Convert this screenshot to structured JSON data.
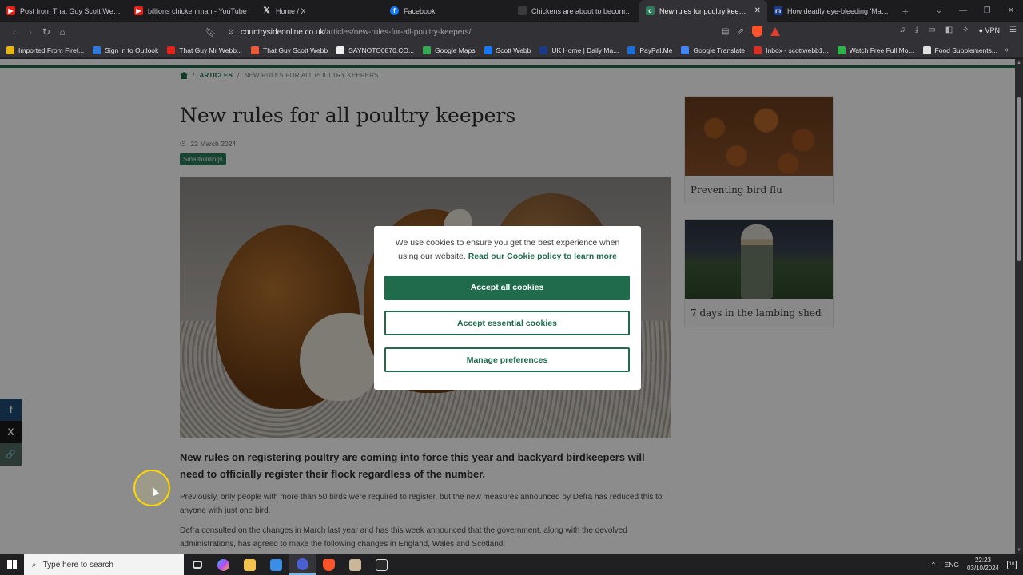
{
  "browser": {
    "tabs": [
      {
        "label": "Post from That Guy Scott Webb - Y",
        "icon": "youtube-icon",
        "color": "#e62117"
      },
      {
        "label": "billions chicken man - YouTube",
        "icon": "youtube-icon",
        "color": "#e62117"
      },
      {
        "label": "Home / X",
        "icon": "x-icon",
        "color": "#e6e6e6"
      },
      {
        "label": "Facebook",
        "icon": "facebook-icon",
        "color": "#1877f2"
      },
      {
        "label": "Chickens are about to become illeg",
        "icon": "generic-icon",
        "color": "#3a3a3a"
      },
      {
        "label": "New rules for poultry keepers",
        "icon": "countryside-icon",
        "color": "#2b7a5a",
        "active": true
      },
      {
        "label": "How deadly eye-bleeding 'Marburg",
        "icon": "newspaper-icon",
        "color": "#1a3a8a"
      }
    ],
    "url_domain": "countrysideonline.co.uk",
    "url_path": "/articles/new-rules-for-all-poultry-keepers/",
    "vpn_label": "VPN",
    "bookmarks": [
      {
        "label": "Imported From Firef...",
        "color": "#e7b416"
      },
      {
        "label": "Sign in to Outlook",
        "color": "#2f7ad8"
      },
      {
        "label": "That Guy Mr Webb...",
        "color": "#e62117"
      },
      {
        "label": "That Guy Scott Webb",
        "color": "#ef5a3a"
      },
      {
        "label": "SAYNOTO0870.CO...",
        "color": "#f0f0f0"
      },
      {
        "label": "Google Maps",
        "color": "#34a853"
      },
      {
        "label": "Scott Webb",
        "color": "#1877f2"
      },
      {
        "label": "UK Home | Daily Ma...",
        "color": "#1a3a8a"
      },
      {
        "label": "PayPal.Me",
        "color": "#1a6ed8"
      },
      {
        "label": "Google Translate",
        "color": "#4285f4"
      },
      {
        "label": "Inbox - scottwebb1...",
        "color": "#d93025"
      },
      {
        "label": "Watch Free Full Mo...",
        "color": "#2db34a"
      },
      {
        "label": "Food Supplements...",
        "color": "#e0e0e0"
      }
    ]
  },
  "breadcrumb": {
    "articles": "ARTICLES",
    "current": "NEW RULES FOR ALL POULTRY KEEPERS"
  },
  "article": {
    "title": "New rules for all poultry keepers",
    "date": "22 March 2024",
    "tag": "Smallholdings",
    "lead": "New rules on registering poultry are coming into force this year and backyard birdkeepers will need to officially register their flock regardless of the number.",
    "p1": "Previously, only people with more than 50 birds were required to register, but the new measures announced by Defra has reduced this to anyone with just one bird.",
    "p2": "Defra consulted on the changes in March last year and has this week announced that the government, along with the devolved administrations, has agreed to make the following changes in England, Wales and Scotland:"
  },
  "sidebar": {
    "card1": "Preventing bird flu",
    "card2": "7 days in the lambing shed"
  },
  "cookie_modal": {
    "text": "We use cookies to ensure you get the best experience when using our website.",
    "link": "Read our Cookie policy to learn more",
    "accept_all": "Accept all cookies",
    "accept_essential": "Accept essential cookies",
    "manage": "Manage preferences"
  },
  "share": {
    "facebook": "f",
    "x": "X",
    "link": "🔗"
  },
  "taskbar": {
    "search_placeholder": "Type here to search",
    "lang": "ENG",
    "time": "22:23",
    "date": "03/10/2024",
    "notif_count": "10"
  },
  "colors": {
    "brand_green": "#1f6b4c",
    "tag_green": "#2b7a5a"
  }
}
